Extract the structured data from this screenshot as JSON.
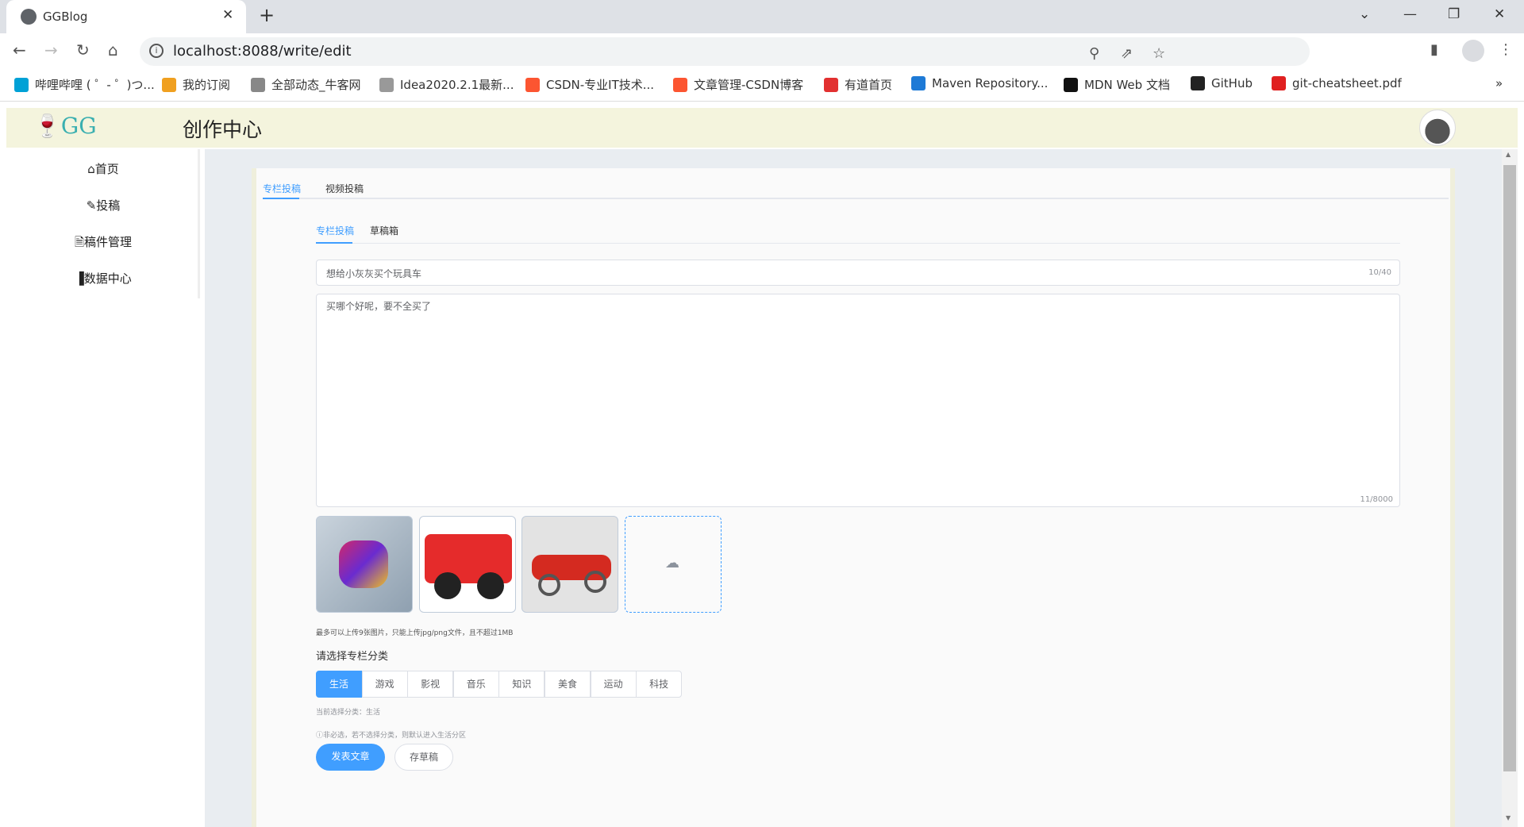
{
  "browser": {
    "tab_title": "GGBlog",
    "url": "localhost:8088/write/edit",
    "bookmarks": [
      {
        "label": "哔哩哔哩 ( ゜- ゜)つ...",
        "icon": "bilibili-icon",
        "color": "#00a1d6"
      },
      {
        "label": "我的订阅",
        "icon": "subscribe-icon",
        "color": "#f0a020"
      },
      {
        "label": "全部动态_牛客网",
        "icon": "nowcoder-icon",
        "color": "#888888"
      },
      {
        "label": "Idea2020.2.1最新...",
        "icon": "image-icon",
        "color": "#999999"
      },
      {
        "label": "CSDN-专业IT技术...",
        "icon": "csdn-icon",
        "color": "#fc5531"
      },
      {
        "label": "文章管理-CSDN博客",
        "icon": "csdn-icon",
        "color": "#fc5531"
      },
      {
        "label": "有道首页",
        "icon": "youdao-icon",
        "color": "#e23030"
      },
      {
        "label": "Maven Repository...",
        "icon": "maven-icon",
        "color": "#1e7ad6"
      },
      {
        "label": "MDN Web 文档",
        "icon": "mdn-icon",
        "color": "#111111"
      },
      {
        "label": "GitHub",
        "icon": "github-icon",
        "color": "#222222"
      },
      {
        "label": "git-cheatsheet.pdf",
        "icon": "pdf-icon",
        "color": "#e02020"
      }
    ]
  },
  "header": {
    "logo": "GG",
    "title": "创作中心"
  },
  "sidebar": {
    "items": [
      {
        "label": "首页",
        "icon": "home-icon"
      },
      {
        "label": "投稿",
        "icon": "pencil-icon"
      },
      {
        "label": "稿件管理",
        "icon": "document-icon"
      },
      {
        "label": "数据中心",
        "icon": "bar-chart-icon"
      }
    ]
  },
  "main": {
    "tabs": [
      "专栏投稿",
      "视频投稿"
    ],
    "subtabs": [
      "专栏投稿",
      "草稿箱"
    ],
    "title_value": "想给小灰灰买个玩具车",
    "title_count": "10/40",
    "content_value": "买哪个好呢，要不全买了",
    "content_count": "11/8000",
    "upload_hint": "最多可以上传9张图片，只能上传jpg/png文件，且不超过1MB",
    "category_label": "请选择专栏分类",
    "categories": [
      "生活",
      "游戏",
      "影视",
      "音乐",
      "知识",
      "美食",
      "运动",
      "科技"
    ],
    "selected_category": "生活",
    "current_text": "当前选择分类：生活",
    "note": "ⓘ非必选，若不选择分类，则默认进入生活分区",
    "publish": "发表文章",
    "save_draft": "存草稿"
  },
  "colors": {
    "accent": "#409eff",
    "header_bg": "#f4f4dd",
    "logo": "#3aafb0"
  }
}
